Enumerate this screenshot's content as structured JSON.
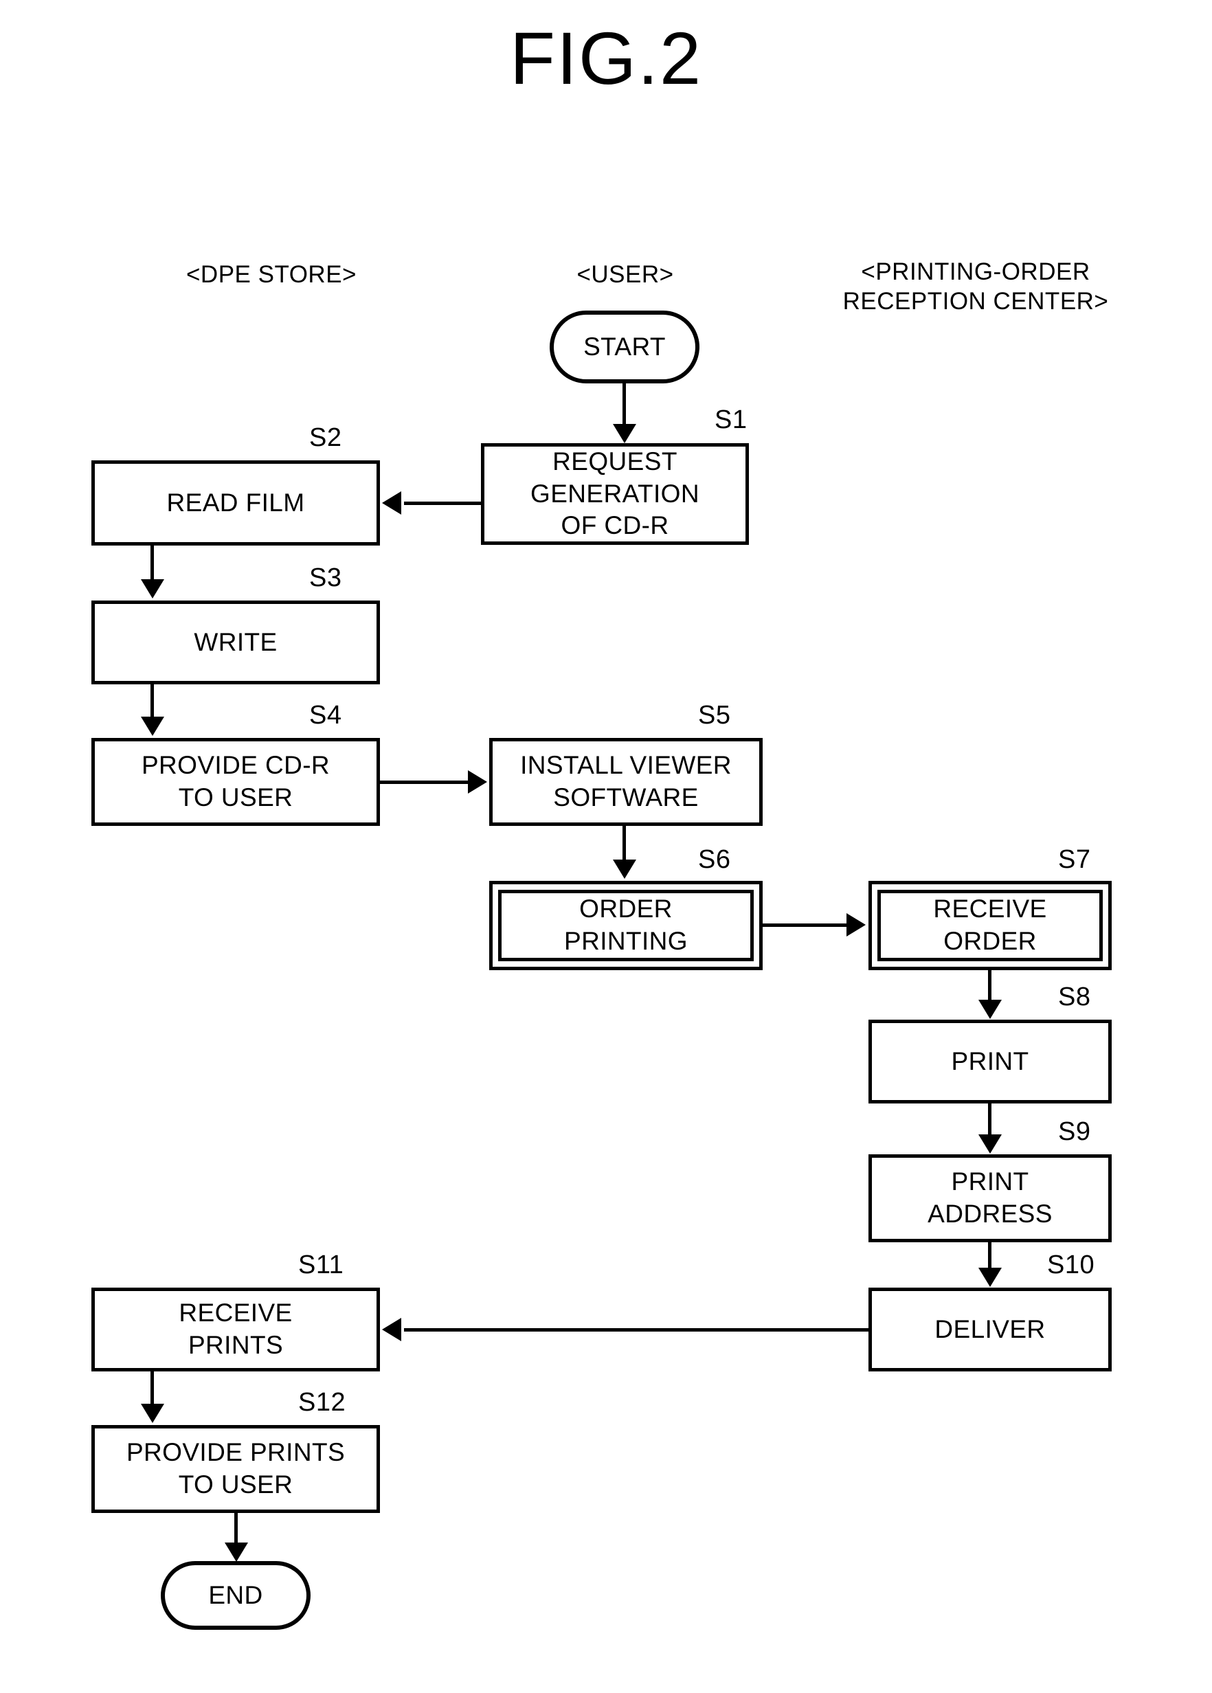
{
  "figure": {
    "title": "FIG.2"
  },
  "lanes": [
    {
      "id": "dpe-store",
      "label": "<DPE STORE>"
    },
    {
      "id": "user",
      "label": "<USER>"
    },
    {
      "id": "printing-order-reception-center",
      "label": "<PRINTING-ORDER\nRECEPTION CENTER>"
    }
  ],
  "nodes": [
    {
      "id": "start",
      "step": "",
      "label": "START",
      "shape": "terminal",
      "lane": "user"
    },
    {
      "id": "s1",
      "step": "S1",
      "label": "REQUEST\nGENERATION\nOF CD-R",
      "shape": "process",
      "lane": "user"
    },
    {
      "id": "s2",
      "step": "S2",
      "label": "READ FILM",
      "shape": "process",
      "lane": "dpe-store"
    },
    {
      "id": "s3",
      "step": "S3",
      "label": "WRITE",
      "shape": "process",
      "lane": "dpe-store"
    },
    {
      "id": "s4",
      "step": "S4",
      "label": "PROVIDE CD-R\nTO USER",
      "shape": "process",
      "lane": "dpe-store"
    },
    {
      "id": "s5",
      "step": "S5",
      "label": "INSTALL VIEWER\nSOFTWARE",
      "shape": "process",
      "lane": "user"
    },
    {
      "id": "s6",
      "step": "S6",
      "label": "ORDER\nPRINTING",
      "shape": "double",
      "lane": "user"
    },
    {
      "id": "s7",
      "step": "S7",
      "label": "RECEIVE\nORDER",
      "shape": "double",
      "lane": "printing-order-reception-center"
    },
    {
      "id": "s8",
      "step": "S8",
      "label": "PRINT",
      "shape": "process",
      "lane": "printing-order-reception-center"
    },
    {
      "id": "s9",
      "step": "S9",
      "label": "PRINT\nADDRESS",
      "shape": "process",
      "lane": "printing-order-reception-center"
    },
    {
      "id": "s10",
      "step": "S10",
      "label": "DELIVER",
      "shape": "process",
      "lane": "printing-order-reception-center"
    },
    {
      "id": "s11",
      "step": "S11",
      "label": "RECEIVE\nPRINTS",
      "shape": "process",
      "lane": "dpe-store"
    },
    {
      "id": "s12",
      "step": "S12",
      "label": "PROVIDE PRINTS\nTO USER",
      "shape": "process",
      "lane": "dpe-store"
    },
    {
      "id": "end",
      "step": "",
      "label": "END",
      "shape": "terminal",
      "lane": "dpe-store"
    }
  ],
  "edges": [
    {
      "from": "start",
      "to": "s1",
      "direction": "down"
    },
    {
      "from": "s1",
      "to": "s2",
      "direction": "left"
    },
    {
      "from": "s2",
      "to": "s3",
      "direction": "down"
    },
    {
      "from": "s3",
      "to": "s4",
      "direction": "down"
    },
    {
      "from": "s4",
      "to": "s5",
      "direction": "right"
    },
    {
      "from": "s5",
      "to": "s6",
      "direction": "down"
    },
    {
      "from": "s6",
      "to": "s7",
      "direction": "right"
    },
    {
      "from": "s7",
      "to": "s8",
      "direction": "down"
    },
    {
      "from": "s8",
      "to": "s9",
      "direction": "down"
    },
    {
      "from": "s9",
      "to": "s10",
      "direction": "down"
    },
    {
      "from": "s10",
      "to": "s11",
      "direction": "left"
    },
    {
      "from": "s11",
      "to": "s12",
      "direction": "down"
    },
    {
      "from": "s12",
      "to": "end",
      "direction": "down"
    }
  ],
  "colors": {
    "stroke": "#000000",
    "background": "#ffffff"
  }
}
